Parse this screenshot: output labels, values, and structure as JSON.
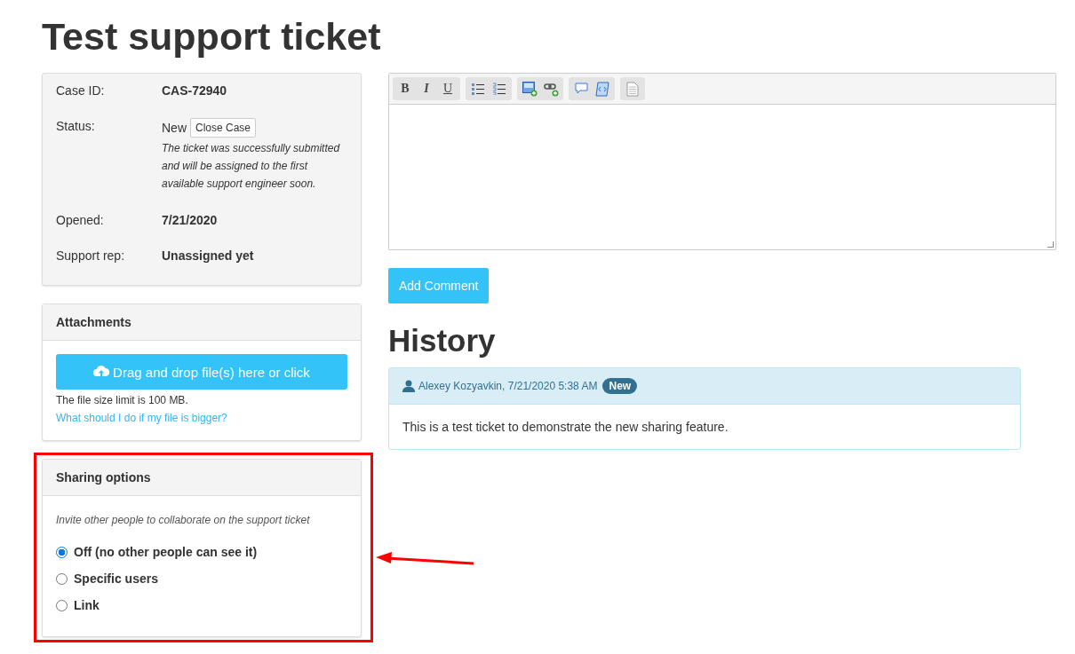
{
  "page_title": "Test support ticket",
  "details": [
    {
      "label": "Case ID:",
      "value": "CAS-72940",
      "kind": "bold"
    },
    {
      "label": "Status:",
      "value": "New",
      "kind": "status",
      "button": "Close Case",
      "note": "The ticket was successfully submitted and will be assigned to the first available support engineer soon."
    },
    {
      "label": "Opened:",
      "value": "7/21/2020",
      "kind": "bold"
    },
    {
      "label": "Support rep:",
      "value": "Unassigned yet",
      "kind": "bold"
    }
  ],
  "attachments": {
    "title": "Attachments",
    "upload_button": "Drag and drop file(s) here or click",
    "limit_text": "The file size limit is 100 MB.",
    "help_link": "What should I do if my file is bigger?"
  },
  "sharing": {
    "title": "Sharing options",
    "hint": "Invite other people to collaborate on the support ticket",
    "options": [
      {
        "label": "Off (no other people can see it)",
        "selected": true
      },
      {
        "label": "Specific users",
        "selected": false
      },
      {
        "label": "Link",
        "selected": false
      }
    ]
  },
  "editor": {
    "toolbar_groups": [
      [
        {
          "kind": "bold",
          "text": "B"
        },
        {
          "kind": "italic",
          "text": "I"
        },
        {
          "kind": "underline",
          "text": "U"
        }
      ],
      [
        {
          "kind": "bullet-list"
        },
        {
          "kind": "numbered-list"
        }
      ],
      [
        {
          "kind": "image"
        },
        {
          "kind": "link"
        }
      ],
      [
        {
          "kind": "comment"
        },
        {
          "kind": "code"
        }
      ],
      [
        {
          "kind": "document"
        }
      ]
    ]
  },
  "add_comment_button": "Add Comment",
  "history": {
    "title": "History",
    "entries": [
      {
        "author": "Alexey Kozyavkin, 7/21/2020 5:38 AM",
        "badge": "New",
        "text": "This is a test ticket to demonstrate the new sharing feature."
      }
    ]
  }
}
